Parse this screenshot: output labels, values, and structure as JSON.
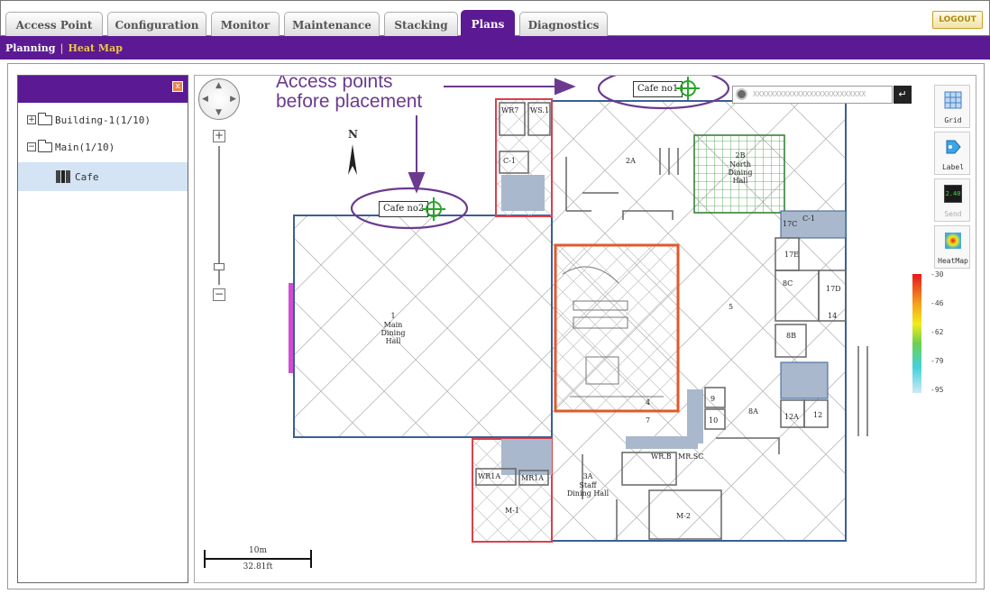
{
  "tabs": [
    {
      "label": "Access Point",
      "active": false
    },
    {
      "label": "Configuration",
      "active": false
    },
    {
      "label": "Monitor",
      "active": false
    },
    {
      "label": "Maintenance",
      "active": false
    },
    {
      "label": "Stacking",
      "active": false
    },
    {
      "label": "Plans",
      "active": true
    },
    {
      "label": "Diagnostics",
      "active": false
    }
  ],
  "logout_label": "LOGOUT",
  "subnav": {
    "planning": "Planning",
    "separator": "|",
    "heatmap": "Heat Map"
  },
  "tree": {
    "close_glyph": "x",
    "items": [
      {
        "expander": "+",
        "label": "Building-1(1/10)"
      },
      {
        "expander": "−",
        "label": "Main(1/10)"
      },
      {
        "label": "Cafe",
        "selected": true
      }
    ]
  },
  "map": {
    "north": "N",
    "zoom_in": "+",
    "zoom_out": "−",
    "search_placeholder": "XXXXXXXXXXXXXXXXXXXXXXXXXX",
    "search_go": "↵",
    "scale_top": "10m",
    "scale_bottom": "32.81ft",
    "access_points": [
      {
        "label": "Cafe no1"
      },
      {
        "label": "Cafe no2"
      }
    ],
    "callout": {
      "line1": "Access points",
      "line2": "before placement"
    },
    "rooms": {
      "main_dining_num": "1",
      "main_dining_name": "Main Dining Hall",
      "north_dining_num": "2B",
      "north_dining_name": "North Dining Hall",
      "staff_dining_num": "3A",
      "staff_dining_name": "Staff Dining Hall",
      "r5": "5",
      "r4": "4",
      "r7": "7",
      "r8a": "8A",
      "r8b": "8B",
      "r8c": "8C",
      "r9": "9",
      "r10": "10",
      "r12": "12",
      "r12a": "12A",
      "r14": "14",
      "r17c": "17C",
      "r17d": "17D",
      "r17e": "17E",
      "r2a": "2A",
      "c1": "C-1",
      "c1b": "C-1",
      "m1": "M-1",
      "m2": "M-2",
      "wr7": "WR7",
      "ws1": "WS.1",
      "wr1a": "WR1A",
      "mr1a": "MR1A",
      "wrb": "WR.B",
      "mrsc": "MR.SC"
    }
  },
  "toolbar": [
    {
      "label": "Grid",
      "enabled": true
    },
    {
      "label": "Label",
      "enabled": true
    },
    {
      "label": "Send",
      "enabled": false,
      "badge": "2.40"
    },
    {
      "label": "HeatMap",
      "enabled": true
    }
  ],
  "legend": {
    "values": [
      "-30",
      "-46",
      "-62",
      "-79",
      "-95"
    ]
  },
  "colors": {
    "brand_purple": "#5b1a93",
    "callout_purple": "#6b3a8f",
    "plan_blue": "#3a5f95",
    "plan_red": "#d9414b",
    "ap_green": "#2aa52a"
  }
}
